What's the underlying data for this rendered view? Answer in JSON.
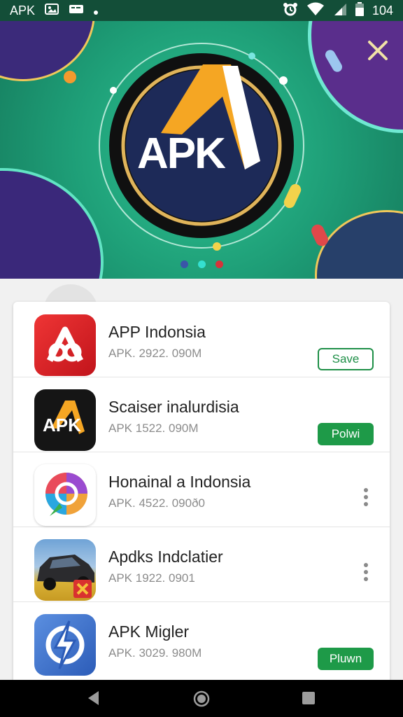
{
  "status_bar": {
    "left_label": "APK",
    "battery_text": "104"
  },
  "hero": {
    "logo_text": "APK",
    "page_indicator": {
      "count": 3,
      "active_index": 1
    }
  },
  "apps": [
    {
      "name": "APP Indonsia",
      "meta": "APK. 2922. 090M",
      "action": {
        "type": "outline",
        "label": "Save"
      }
    },
    {
      "name": "Scaiser inalurdisia",
      "meta": "APK  1522. 090M",
      "action": {
        "type": "filled",
        "label": "Polwi"
      }
    },
    {
      "name": "Honainal a Indonsia",
      "meta": "APK. 4522. 090ð0",
      "action": {
        "type": "overflow"
      }
    },
    {
      "name": "Apdks Indclatier",
      "meta": "APK  1922. 0901",
      "action": {
        "type": "overflow"
      }
    },
    {
      "name": "APK Migler",
      "meta": "APK. 3029. 980M",
      "action": {
        "type": "filled",
        "label": "Pluwn"
      }
    }
  ],
  "icons": {
    "status_left": [
      "screenshot-icon",
      "notification-icon",
      "dot-icon"
    ],
    "status_right": [
      "alarm-icon",
      "wifi-icon",
      "signal-icon",
      "battery-icon"
    ],
    "nav": [
      "back-icon",
      "home-icon",
      "recents-icon"
    ]
  },
  "colors": {
    "status_bar": "#134e38",
    "hero_green": "#1e9e77",
    "accent_green": "#1e9a48",
    "logo_orange": "#f5a623"
  }
}
